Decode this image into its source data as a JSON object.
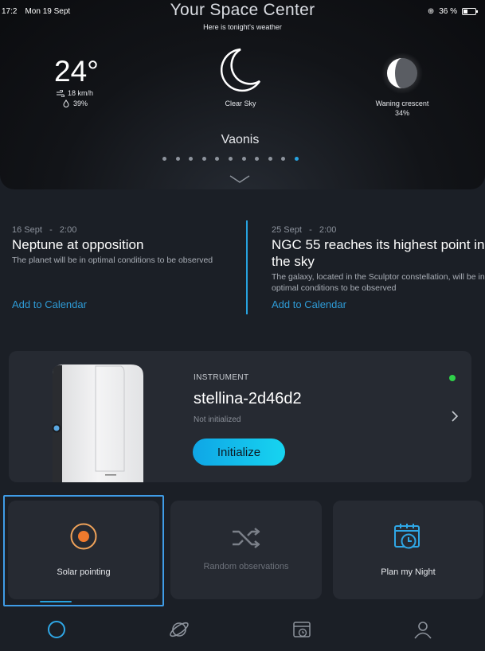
{
  "status_bar": {
    "time": "17:2",
    "date": "Mon 19 Sept",
    "battery": "36 %"
  },
  "hero": {
    "title": "Your Space Center",
    "subtitle": "Here is tonight's weather",
    "temperature": "24°",
    "wind": "18 km/h",
    "humidity": "39%",
    "sky": "Clear Sky",
    "moon_phase": "Waning crescent",
    "moon_pct": "34%",
    "location": "Vaonis",
    "page_count": 11,
    "active_page": 10,
    "accent": "#27a3e0"
  },
  "events": [
    {
      "date": "16 Sept",
      "time": "2:00",
      "title": "Neptune at opposition",
      "description": "The planet will be in optimal conditions to be observed",
      "link": "Add to Calendar"
    },
    {
      "date": "25 Sept",
      "time": "2:00",
      "title": "NGC 55 reaches its highest point in the sky",
      "description": "The galaxy, located in the Sculptor constellation, will be in optimal conditions to be observed",
      "link": "Add to Calendar"
    }
  ],
  "instrument": {
    "label": "INSTRUMENT",
    "name": "stellina-2d46d2",
    "status": "Not initialized",
    "button": "Initialize",
    "online_color": "#2fd14a"
  },
  "tiles": {
    "solar": {
      "label": "Solar pointing",
      "icon": "sun-target-icon"
    },
    "random": {
      "label": "Random observations",
      "icon": "shuffle-icon"
    },
    "plan": {
      "label": "Plan my Night",
      "icon": "calendar-clock-icon"
    }
  },
  "nav": {
    "items": [
      "home-icon",
      "planet-icon",
      "calendar-icon",
      "profile-icon"
    ]
  }
}
